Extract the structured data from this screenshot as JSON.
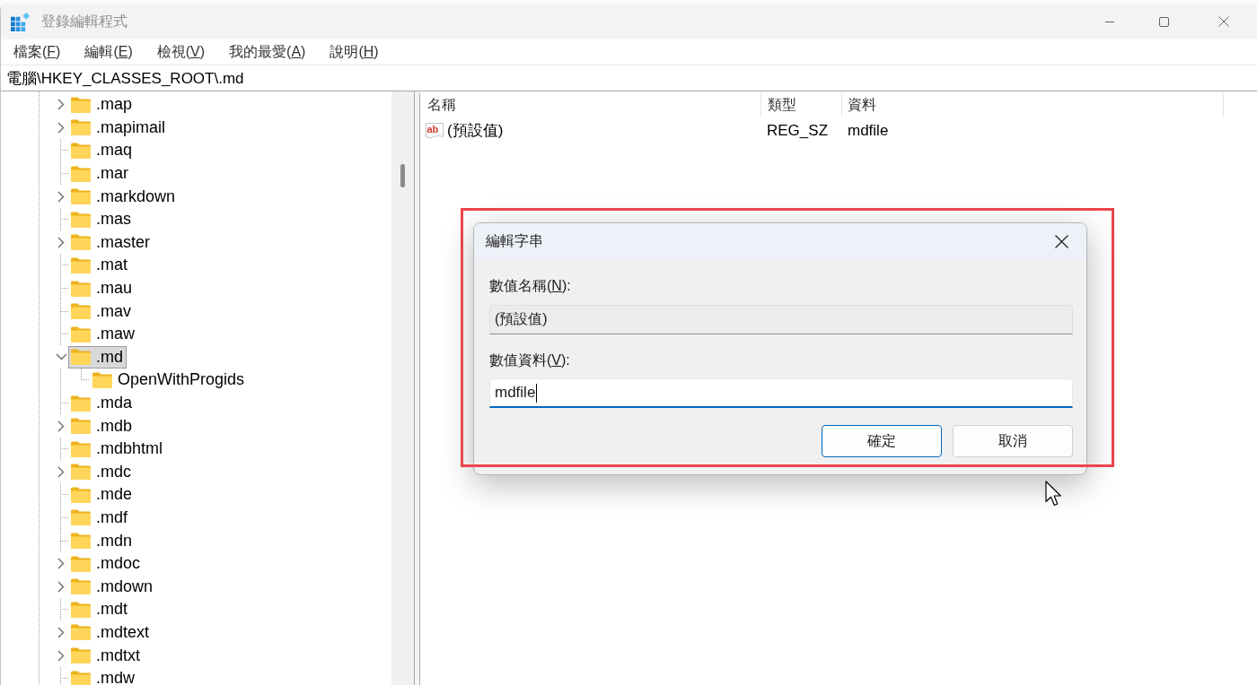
{
  "window": {
    "title": "登錄編輯程式",
    "active": false
  },
  "menu": [
    {
      "prefix": "檔案(",
      "key": "F",
      "suffix": ")"
    },
    {
      "prefix": "編輯(",
      "key": "E",
      "suffix": ")"
    },
    {
      "prefix": "檢視(",
      "key": "V",
      "suffix": ")"
    },
    {
      "prefix": "我的最愛(",
      "key": "A",
      "suffix": ")"
    },
    {
      "prefix": "說明(",
      "key": "H",
      "suffix": ")"
    }
  ],
  "address_bar": {
    "path": "電腦\\HKEY_CLASSES_ROOT\\.md"
  },
  "tree": {
    "items": [
      {
        "name": ".map",
        "expandable": true,
        "expanded": false,
        "selected": false
      },
      {
        "name": ".mapimail",
        "expandable": true,
        "expanded": false,
        "selected": false
      },
      {
        "name": ".maq",
        "expandable": false,
        "expanded": false,
        "selected": false
      },
      {
        "name": ".mar",
        "expandable": false,
        "expanded": false,
        "selected": false
      },
      {
        "name": ".markdown",
        "expandable": true,
        "expanded": false,
        "selected": false
      },
      {
        "name": ".mas",
        "expandable": false,
        "expanded": false,
        "selected": false
      },
      {
        "name": ".master",
        "expandable": true,
        "expanded": false,
        "selected": false
      },
      {
        "name": ".mat",
        "expandable": false,
        "expanded": false,
        "selected": false
      },
      {
        "name": ".mau",
        "expandable": false,
        "expanded": false,
        "selected": false
      },
      {
        "name": ".mav",
        "expandable": false,
        "expanded": false,
        "selected": false
      },
      {
        "name": ".maw",
        "expandable": false,
        "expanded": false,
        "selected": false
      },
      {
        "name": ".md",
        "expandable": true,
        "expanded": true,
        "selected": true,
        "children": [
          {
            "name": "OpenWithProgids",
            "expandable": false,
            "expanded": false,
            "selected": false
          }
        ]
      },
      {
        "name": ".mda",
        "expandable": false,
        "expanded": false,
        "selected": false
      },
      {
        "name": ".mdb",
        "expandable": true,
        "expanded": false,
        "selected": false
      },
      {
        "name": ".mdbhtml",
        "expandable": false,
        "expanded": false,
        "selected": false
      },
      {
        "name": ".mdc",
        "expandable": true,
        "expanded": false,
        "selected": false
      },
      {
        "name": ".mde",
        "expandable": false,
        "expanded": false,
        "selected": false
      },
      {
        "name": ".mdf",
        "expandable": false,
        "expanded": false,
        "selected": false
      },
      {
        "name": ".mdn",
        "expandable": false,
        "expanded": false,
        "selected": false
      },
      {
        "name": ".mdoc",
        "expandable": true,
        "expanded": false,
        "selected": false
      },
      {
        "name": ".mdown",
        "expandable": true,
        "expanded": false,
        "selected": false
      },
      {
        "name": ".mdt",
        "expandable": false,
        "expanded": false,
        "selected": false
      },
      {
        "name": ".mdtext",
        "expandable": true,
        "expanded": false,
        "selected": false
      },
      {
        "name": ".mdtxt",
        "expandable": true,
        "expanded": false,
        "selected": false
      },
      {
        "name": ".mdw",
        "expandable": false,
        "expanded": false,
        "selected": false
      }
    ]
  },
  "values": {
    "columns": [
      "名稱",
      "類型",
      "資料"
    ],
    "rows": [
      {
        "icon_text": "ab",
        "name": "(預設值)",
        "type": "REG_SZ",
        "data": "mdfile"
      }
    ]
  },
  "dialog": {
    "title": "編輯字串",
    "fields": [
      {
        "label": {
          "prefix": "數值名稱(",
          "key": "N",
          "suffix": "):"
        },
        "value": "(預設值)",
        "read_only": true,
        "focused": false
      },
      {
        "label": {
          "prefix": "數值資料(",
          "key": "V",
          "suffix": "):"
        },
        "value": "mdfile",
        "read_only": false,
        "focused": true
      }
    ],
    "buttons": [
      {
        "label": "確定",
        "default": true
      },
      {
        "label": "取消",
        "default": false
      }
    ]
  }
}
